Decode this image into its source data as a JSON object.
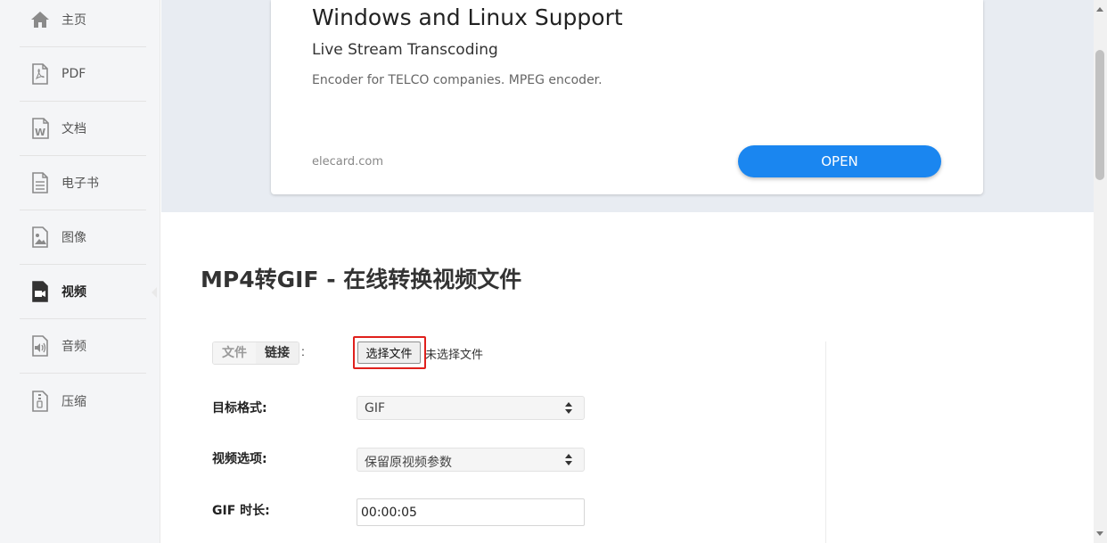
{
  "sidebar": {
    "items": [
      {
        "label": "主页",
        "icon": "home-icon"
      },
      {
        "label": "PDF",
        "icon": "pdf-icon"
      },
      {
        "label": "文档",
        "icon": "word-document-icon"
      },
      {
        "label": "电子书",
        "icon": "ebook-icon"
      },
      {
        "label": "图像",
        "icon": "image-icon"
      },
      {
        "label": "视频",
        "icon": "video-icon",
        "active": true
      },
      {
        "label": "音频",
        "icon": "audio-icon"
      },
      {
        "label": "压缩",
        "icon": "archive-icon"
      }
    ]
  },
  "ad": {
    "title": "Windows and Linux Support",
    "subtitle": "Live Stream Transcoding",
    "description": "Encoder for TELCO companies. MPEG encoder.",
    "domain": "elecard.com",
    "button_label": "OPEN",
    "button_color": "#1a86f0"
  },
  "main": {
    "page_title": "MP4转GIF - 在线转换视频文件",
    "source_tabs": {
      "file": "文件",
      "link": "链接",
      "colon": ":"
    },
    "file_button_label": "选择文件",
    "file_status": "未选择文件",
    "target_format": {
      "label": "目标格式:",
      "value": "GIF"
    },
    "video_options": {
      "label": "视频选项:",
      "value": "保留原视频参数"
    },
    "gif_duration": {
      "label": "GIF 时长:",
      "value": "00:00:05"
    }
  },
  "colors": {
    "highlight": "#e0201c"
  }
}
